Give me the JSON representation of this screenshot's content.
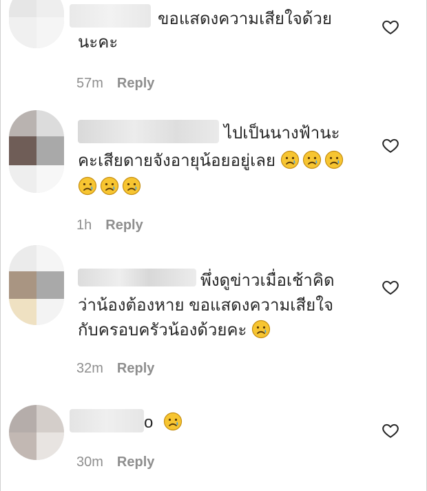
{
  "comments": [
    {
      "lines": [
        "ขอแสดงความเสียใจด้วย",
        "นะคะ"
      ],
      "emoji_line": [],
      "time": "57m",
      "reply_label": "Reply"
    },
    {
      "lines": [
        "ไปเป็นนางฟ้านะ",
        "คะเสียดายจังอายุน้อยอยู่เลย"
      ],
      "inline_emoji_count": 3,
      "emoji_line_count": 3,
      "time": "1h",
      "reply_label": "Reply"
    },
    {
      "lines": [
        "พึ่งดูข่าวเมื่อเช้าคิด",
        "ว่าน้องต้องหาย ขอแสดงความเสียใจ",
        "กับครอบครัวน้องด้วยคะ"
      ],
      "inline_emoji_count": 1,
      "time": "32m",
      "reply_label": "Reply"
    },
    {
      "lines": [
        "o"
      ],
      "inline_emoji_count": 1,
      "time": "30m",
      "reply_label": "Reply"
    }
  ],
  "icons": {
    "like": "heart-outline-icon",
    "emoji": "crying-face-emoji"
  },
  "colors": {
    "text": "#262626",
    "meta": "#8e8e8e",
    "emoji_face": "#f7c531",
    "tear": "#4aa3df"
  }
}
